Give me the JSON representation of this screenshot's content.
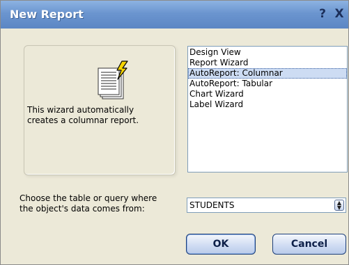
{
  "window": {
    "title": "New Report",
    "help_label": "?",
    "close_label": "X"
  },
  "preview": {
    "icon": "report-wizard-icon",
    "description_line1": "This wizard automatically",
    "description_line2": "creates a columnar report."
  },
  "wizards": {
    "items": [
      {
        "label": "Design View"
      },
      {
        "label": "Report Wizard"
      },
      {
        "label": "AutoReport: Columnar"
      },
      {
        "label": "AutoReport: Tabular"
      },
      {
        "label": "Chart Wizard"
      },
      {
        "label": "Label Wizard"
      }
    ],
    "selected_index": 2
  },
  "source": {
    "prompt_line1": "Choose the table or query where",
    "prompt_line2": "the object's data comes from:",
    "value": "STUDENTS"
  },
  "buttons": {
    "ok": "OK",
    "cancel": "Cancel"
  },
  "colors": {
    "titlebar": "#6b95cf",
    "selection": "#cddcf3",
    "background": "#ece9d8"
  }
}
